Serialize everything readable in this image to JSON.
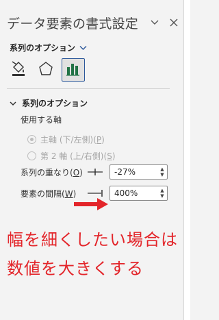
{
  "pane": {
    "title": "データ要素の書式設定",
    "dropdown_glyph": "∨",
    "close_glyph": "×"
  },
  "options_menu": {
    "label": "系列のオプション",
    "chevron": "∨"
  },
  "tabs": [
    {
      "name": "fill-line",
      "icon": "paint-bucket-icon",
      "active": false
    },
    {
      "name": "effects",
      "icon": "pentagon-icon",
      "active": false
    },
    {
      "name": "series-options",
      "icon": "bar-chart-icon",
      "active": true
    }
  ],
  "section": {
    "title": "系列のオプション",
    "chevron": "∨",
    "axis_label": "使用する軸",
    "primary_axis": {
      "label": "主軸 (下/左側)",
      "key": "P",
      "checked": true
    },
    "secondary_axis": {
      "label": "第 2 軸 (上/右側)",
      "key": "S",
      "checked": false
    },
    "overlap": {
      "label": "系列の重なり",
      "key": "O",
      "value": "-27%"
    },
    "gap": {
      "label": "要素の間隔",
      "key": "W",
      "value": "400%"
    }
  },
  "annotation": {
    "line1": "幅を細くしたい場合は",
    "line2": "数値を大きくする",
    "color": "#e3252a"
  }
}
